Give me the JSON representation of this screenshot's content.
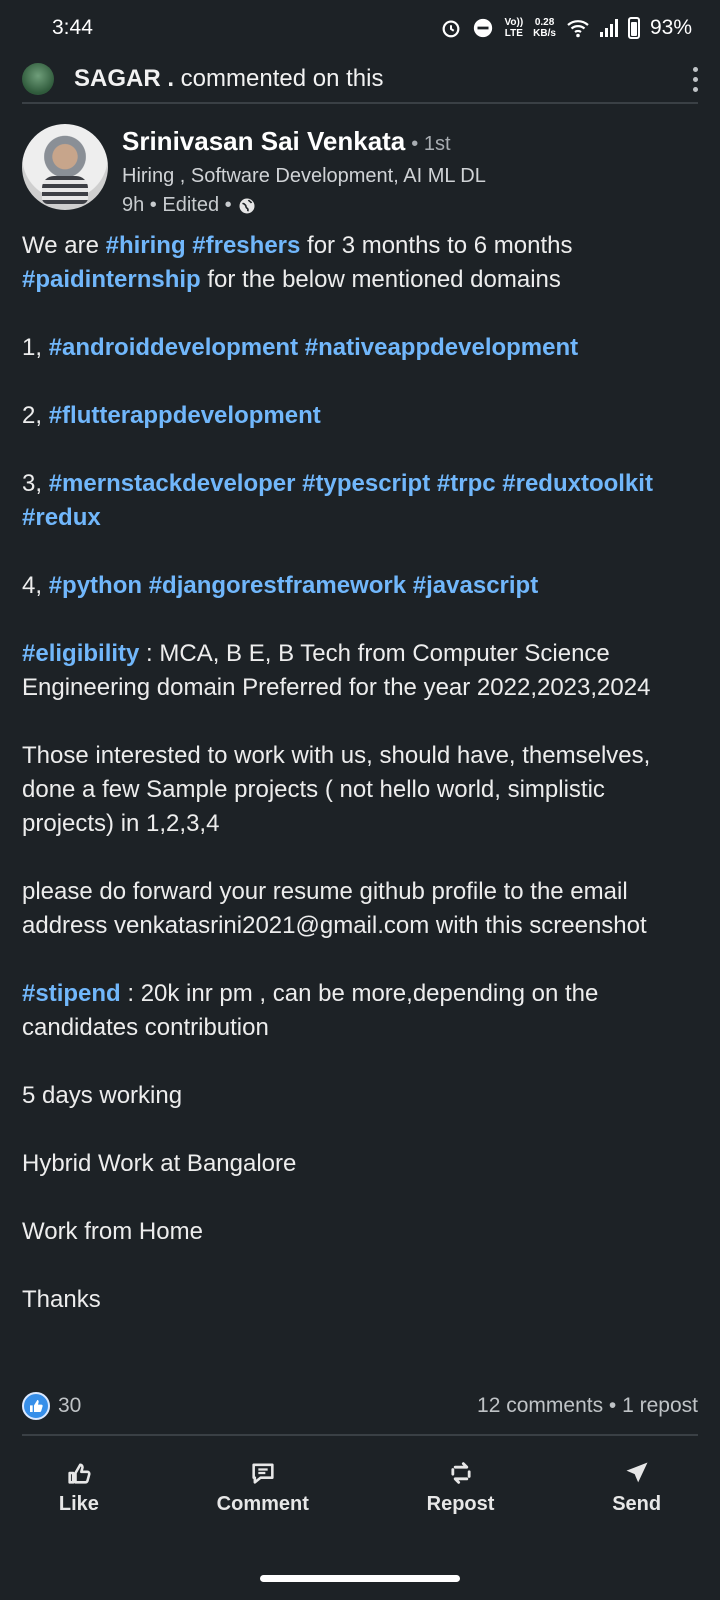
{
  "status": {
    "time": "3:44",
    "network_top": "0.28",
    "network_bottom": "KB/s",
    "volte_top": "Vo))",
    "volte_bottom": "LTE",
    "battery": "93%"
  },
  "activity": {
    "actor": "SAGAR .",
    "action": " commented on this"
  },
  "author": {
    "name": "Srinivasan Sai Venkata",
    "degree": "• 1st",
    "headline": "Hiring , Software Development, AI ML DL",
    "meta": "9h • Edited •"
  },
  "post": {
    "l1a": "We are ",
    "t_hiring": "#hiring",
    "t_freshers": "#freshers",
    "l1b": " for 3 months to 6 months",
    "t_paid": "#paidinternship",
    "l1c": " for the below mentioned domains",
    "n1": "1, ",
    "t_android": "#androiddevelopment",
    "t_native": "#nativeappdevelopment",
    "n2": "2, ",
    "t_flutter": "#flutterappdevelopment",
    "n3": "3, ",
    "t_mern": "#mernstackdeveloper",
    "t_ts": "#typescript",
    "t_trpc": "#trpc",
    "t_rtk": "#reduxtoolkit",
    "t_redux": "#redux",
    "n4": "4, ",
    "t_python": "#python",
    "t_drf": "#djangorestframework",
    "t_js": "#javascript",
    "t_elig": "#eligibility",
    "elig": " : MCA, B E, B Tech from Computer Science Engineering domain Preferred for the year 2022,2023,2024",
    "para_interest": "Those interested to work with us, should have, themselves, done a few Sample projects ( not hello world, simplistic projects) in 1,2,3,4",
    "para_forward": "please do forward your resume github profile to the email address venkatasrini2021@gmail.com with this screenshot",
    "t_stipend": "#stipend",
    "stipend": " : 20k inr pm , can be more,depending on the candidates contribution",
    "days": "5 days working",
    "hybrid": "Hybrid Work at Bangalore",
    "wfh": "Work from Home",
    "thanks": "Thanks"
  },
  "reactions": {
    "count": "30",
    "summary": "12 comments • 1 repost"
  },
  "actions": {
    "like": "Like",
    "comment": "Comment",
    "repost": "Repost",
    "send": "Send"
  }
}
